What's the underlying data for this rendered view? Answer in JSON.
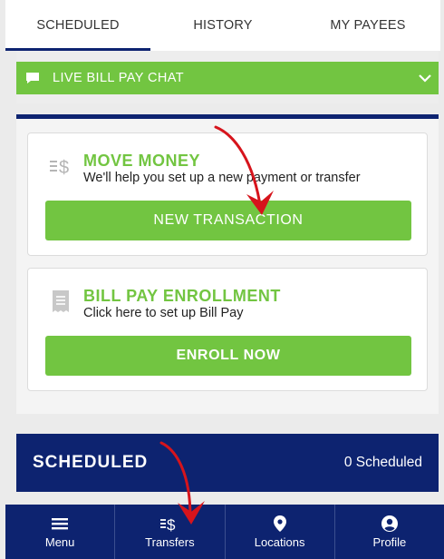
{
  "tabs": [
    {
      "label": "SCHEDULED",
      "active": true
    },
    {
      "label": "HISTORY",
      "active": false
    },
    {
      "label": "MY PAYEES",
      "active": false
    }
  ],
  "chat": {
    "label": "LIVE BILL PAY CHAT",
    "icon": "chat-bubble-icon",
    "expand_icon": "chevron-down-icon"
  },
  "move_money": {
    "icon": "transfer-dollar-icon",
    "title": "MOVE MONEY",
    "subtitle": "We'll help you set up a new payment or transfer",
    "button": "NEW TRANSACTION"
  },
  "enrollment": {
    "icon": "receipt-icon",
    "title": "BILL PAY ENROLLMENT",
    "subtitle": "Click here to set up Bill Pay",
    "button": "ENROLL NOW"
  },
  "scheduled": {
    "title": "SCHEDULED",
    "count": "0 Scheduled"
  },
  "bottom_nav": [
    {
      "label": "Menu",
      "icon": "hamburger-icon"
    },
    {
      "label": "Transfers",
      "icon": "transfer-dollar-icon"
    },
    {
      "label": "Locations",
      "icon": "location-pin-icon"
    },
    {
      "label": "Profile",
      "icon": "user-circle-icon"
    }
  ],
  "colors": {
    "navy": "#0d2370",
    "green": "#72c541",
    "background": "#ebebeb",
    "annotation_red": "#d6141c"
  }
}
